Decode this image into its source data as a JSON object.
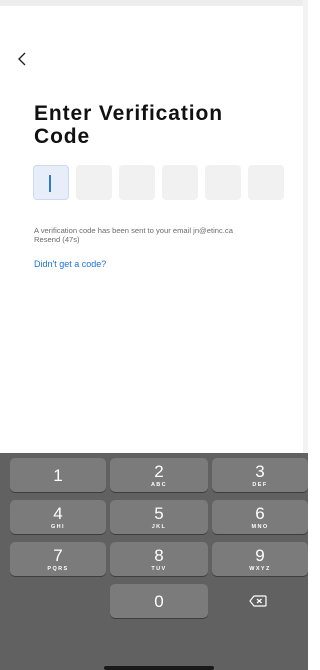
{
  "screen": {
    "title": "Enter Verification Code",
    "info_line1": "A verification code has been sent to your email jn@etinc.ca",
    "info_line2": "Resend (47s)",
    "help_link": "Didn't get a code?"
  },
  "code_boxes": [
    "",
    "",
    "",
    "",
    "",
    ""
  ],
  "keypad": {
    "keys": [
      {
        "num": "1",
        "letters": ""
      },
      {
        "num": "2",
        "letters": "ABC"
      },
      {
        "num": "3",
        "letters": "DEF"
      },
      {
        "num": "4",
        "letters": "GHI"
      },
      {
        "num": "5",
        "letters": "JKL"
      },
      {
        "num": "6",
        "letters": "MNO"
      },
      {
        "num": "7",
        "letters": "PQRS"
      },
      {
        "num": "8",
        "letters": "TUV"
      },
      {
        "num": "9",
        "letters": "WXYZ"
      },
      {
        "num": "0",
        "letters": ""
      }
    ]
  },
  "icons": {
    "back": "chevron-left-icon",
    "delete": "backspace-icon"
  },
  "colors": {
    "accent": "#1a73d9",
    "keyboard_bg": "#616161",
    "key_bg": "#7b7b7b"
  }
}
